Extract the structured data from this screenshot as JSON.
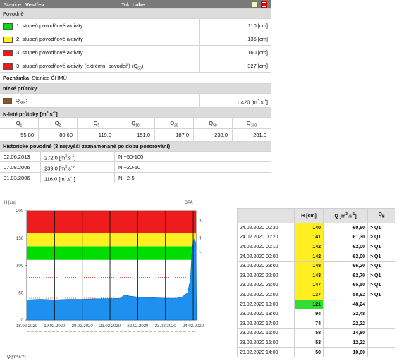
{
  "header": {
    "station_label": "Stanice",
    "station": "Vestřev",
    "river_label": "Tok",
    "river": "Labe"
  },
  "flood": {
    "title": "Povodně",
    "levels": [
      {
        "label": "1. stupeň povodňové aktivity",
        "value": "110 [cm]",
        "color": "#00dd00"
      },
      {
        "label": "2. stupeň povodňové aktivity",
        "value": "135 [cm]",
        "color": "#ffee22"
      },
      {
        "label": "3. stupeň povodňové aktivity",
        "value": "160 [cm]",
        "color": "#ee1c1c"
      },
      {
        "label": "3. stupeň povodňové aktivity",
        "extreme": "extrémní povodeň) (Q",
        "extreme_sub": "50",
        "extreme_end": ")",
        "value": "327 [cm]",
        "color": "#ee1c1c"
      }
    ],
    "note_label": "Poznámka",
    "note": "Stanice ČHMÚ"
  },
  "low": {
    "title": "nízké průtoky",
    "label": "Q",
    "label_sub": "355",
    "label_end": ":",
    "value": "1,420 [m",
    "value_sup": "3",
    "value_mid": ".s",
    "value_sup2": "-1",
    "value_end": "]",
    "color": "#8b5a1a"
  },
  "nlet": {
    "title": "N-leté průtoky [m",
    "title_sup": "3",
    "title_mid": ".s",
    "title_sup2": "-1",
    "title_end": "]",
    "columns": [
      "Q1",
      "Q2",
      "Q5",
      "Q10",
      "Q20",
      "Q50",
      "Q100"
    ],
    "values": [
      "55,80",
      "80,60",
      "119,0",
      "151,0",
      "187,0",
      "238,0",
      "281,0"
    ]
  },
  "historic": {
    "title": "Historické povodně (3 nejvyšší zaznamenané po dobu pozorování)",
    "rows": [
      {
        "date": "02.06.2013",
        "q": "272,0 [m",
        "n": "N −50-100"
      },
      {
        "date": "07.08.2006",
        "q": "239,0 [m",
        "n": "N −20-50"
      },
      {
        "date": "31.03.2006",
        "q": "116,0 [m",
        "n": "N −2-5"
      }
    ],
    "unit_sup": "3",
    "unit_mid": ".s",
    "unit_sup2": "-1",
    "unit_end": "]"
  },
  "chart_data": {
    "type": "area",
    "ylabel": "H [cm]",
    "corner": "SPA",
    "ylim": [
      0,
      200
    ],
    "yticks": [
      "0",
      "50",
      "100",
      "150",
      "200"
    ],
    "x": [
      "18.02.2020",
      "19.02.2020",
      "20.02.2020",
      "21.02.2020",
      "22.02.2020",
      "23.02.2020",
      "24.02.2020"
    ],
    "zones": [
      {
        "from": 110,
        "to": 135,
        "color": "#00dd00",
        "label": "I."
      },
      {
        "from": 135,
        "to": 160,
        "color": "#ffee22",
        "label": "II."
      },
      {
        "from": 160,
        "to": 200,
        "color": "#ee1c1c",
        "label": "III."
      }
    ],
    "series": [
      {
        "values": [
          [
            0,
            37
          ],
          [
            0.5,
            38
          ],
          [
            1,
            37
          ],
          [
            1.5,
            38
          ],
          [
            2,
            38
          ],
          [
            2.5,
            39
          ],
          [
            3,
            39
          ],
          [
            3.4,
            40
          ],
          [
            3.5,
            46
          ],
          [
            3.7,
            44
          ],
          [
            4,
            42
          ],
          [
            4.5,
            41
          ],
          [
            5,
            40
          ],
          [
            5.4,
            40
          ],
          [
            5.6,
            42
          ],
          [
            5.8,
            50
          ],
          [
            5.9,
            75
          ],
          [
            5.95,
            120
          ],
          [
            6.0,
            145
          ],
          [
            6.05,
            148
          ],
          [
            6.1,
            140
          ],
          [
            6.12,
            0
          ]
        ],
        "color": "#1e90ef"
      }
    ],
    "dotted": [
      327,
      40,
      78
    ],
    "q_label": "Q [m³.s⁻¹]"
  },
  "obs": {
    "headers": [
      "",
      "H [cm]",
      "Q [m3.s-1]",
      "QN"
    ],
    "rows": [
      {
        "t": "24.02.2020 00:30",
        "h": "140",
        "q": "60,60",
        "qn": "> Q1",
        "hc": "#ffee22"
      },
      {
        "t": "24.02.2020 00:20",
        "h": "141",
        "q": "61,30",
        "qn": "> Q1",
        "hc": "#ffee22"
      },
      {
        "t": "24.02.2020 00:10",
        "h": "142",
        "q": "62,00",
        "qn": "> Q1",
        "hc": "#ffee22"
      },
      {
        "t": "24.02.2020 00:00",
        "h": "142",
        "q": "62,00",
        "qn": "> Q1",
        "hc": "#ffee22"
      },
      {
        "t": "23.02.2020 23:00",
        "h": "148",
        "q": "66,20",
        "qn": "> Q1",
        "hc": "#ffee22"
      },
      {
        "t": "23.02.2020 22:00",
        "h": "143",
        "q": "62,70",
        "qn": "> Q1",
        "hc": "#ffee22"
      },
      {
        "t": "23.02.2020 21:00",
        "h": "147",
        "q": "65,50",
        "qn": "> Q1",
        "hc": "#ffee22"
      },
      {
        "t": "23.02.2020 20:00",
        "h": "137",
        "q": "58,62",
        "qn": "> Q1",
        "hc": "#ffee22"
      },
      {
        "t": "23.02.2020 19:00",
        "h": "121",
        "q": "48,24",
        "qn": "",
        "hc": "#33dd33"
      },
      {
        "t": "23.02.2020 18:00",
        "h": "94",
        "q": "32,48",
        "qn": "",
        "hc": ""
      },
      {
        "t": "23.02.2020 17:00",
        "h": "74",
        "q": "22,22",
        "qn": "",
        "hc": ""
      },
      {
        "t": "23.02.2020 16:00",
        "h": "58",
        "q": "14,80",
        "qn": "",
        "hc": ""
      },
      {
        "t": "23.02.2020 15:00",
        "h": "53",
        "q": "12,22",
        "qn": "",
        "hc": ""
      },
      {
        "t": "23.02.2020 14:00",
        "h": "50",
        "q": "10,60",
        "qn": "",
        "hc": ""
      }
    ]
  }
}
